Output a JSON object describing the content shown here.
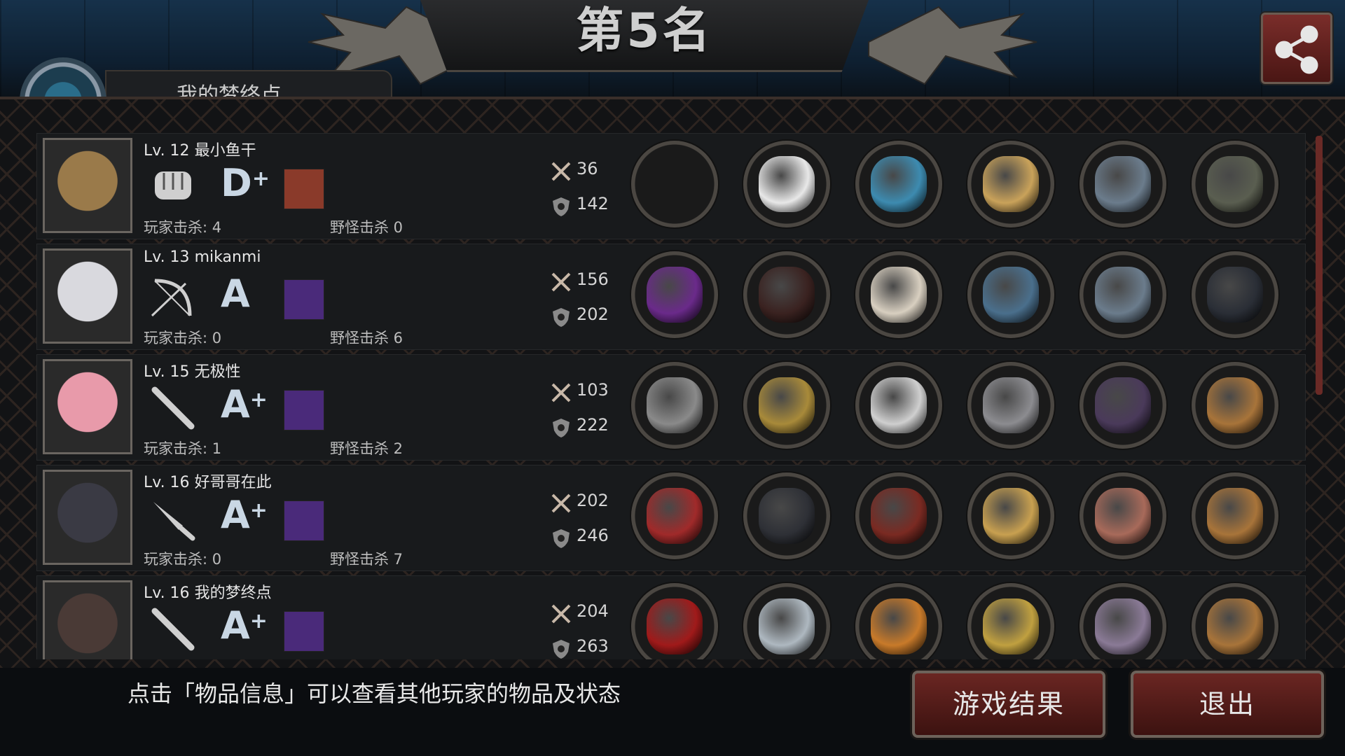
{
  "header": {
    "title": "第5名",
    "profile_tab_label": "我的梦终点"
  },
  "players": [
    {
      "level": "Lv. 12",
      "name": "最小鱼干",
      "grade": "D",
      "grade_plus": "+",
      "player_kills": "玩家击杀: 4",
      "monster_kills": "野怪击杀 0",
      "attack": "36",
      "defense": "142",
      "avatar_color": "#9a7a4a",
      "weapon_icon": "fist-icon",
      "skill_color": "#8a3a2a",
      "items": [
        "#111111",
        "#e8e8e8",
        "#3d8bb0",
        "#c9a25a",
        "#6b7c8c",
        "#5a5e50"
      ]
    },
    {
      "level": "Lv. 13",
      "name": "mikanmi",
      "grade": "A",
      "grade_plus": "",
      "player_kills": "玩家击杀: 0",
      "monster_kills": "野怪击杀 6",
      "attack": "156",
      "defense": "202",
      "avatar_color": "#d9d9de",
      "weapon_icon": "bow-icon",
      "skill_color": "#4a2a7a",
      "items": [
        "#6a2a8a",
        "#3a2220",
        "#d8cfc0",
        "#4a6f8c",
        "#6b7c8c",
        "#2a2e36"
      ]
    },
    {
      "level": "Lv. 15",
      "name": "无极性",
      "grade": "A",
      "grade_plus": "+",
      "player_kills": "玩家击杀: 1",
      "monster_kills": "野怪击杀 2",
      "attack": "103",
      "defense": "222",
      "avatar_color": "#e89aaa",
      "weapon_icon": "bat-icon",
      "skill_color": "#4a2a7a",
      "items": [
        "#8a8a8a",
        "#a88a3a",
        "#cfcfcf",
        "#8c8c90",
        "#4a3a5a",
        "#a8743a"
      ]
    },
    {
      "level": "Lv. 16",
      "name": "好哥哥在此",
      "grade": "A",
      "grade_plus": "+",
      "player_kills": "玩家击杀: 0",
      "monster_kills": "野怪击杀 7",
      "attack": "202",
      "defense": "246",
      "avatar_color": "#3a3a44",
      "weapon_icon": "knife-icon",
      "skill_color": "#4a2a7a",
      "items": [
        "#a02a2a",
        "#2e3036",
        "#7a2a22",
        "#c8a050",
        "#a86a5a",
        "#a8743a"
      ]
    },
    {
      "level": "Lv. 16",
      "name": "我的梦终点",
      "grade": "A",
      "grade_plus": "+",
      "player_kills": "",
      "monster_kills": "",
      "attack": "204",
      "defense": "263",
      "avatar_color": "#4a3a36",
      "weapon_icon": "bat-icon",
      "skill_color": "#4a2a7a",
      "items": [
        "#a01a1a",
        "#aeb8c0",
        "#c87a2a",
        "#c0a040",
        "#8a7a96",
        "#a8743a"
      ]
    }
  ],
  "footer": {
    "hint": "点击「物品信息」可以查看其他玩家的物品及状态",
    "result_button": "游戏结果",
    "exit_button": "退出"
  },
  "colors": {
    "accent": "#6a2622",
    "title": "#cfcfcf"
  }
}
